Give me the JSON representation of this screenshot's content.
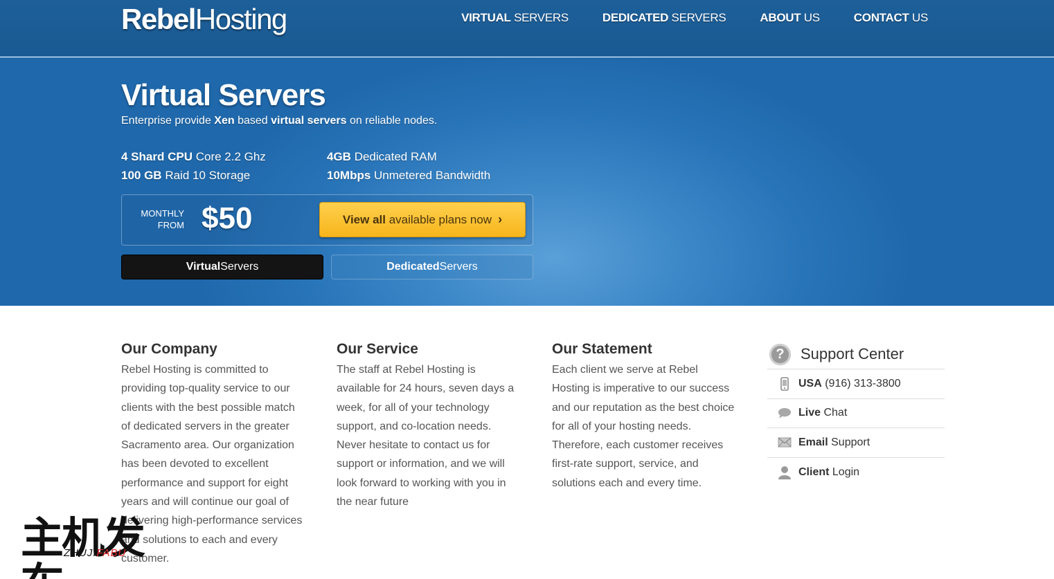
{
  "header": {
    "logo_bold": "Rebel",
    "logo_light": "Hosting",
    "nav": [
      {
        "bold": "VIRTUAL",
        "rest": " SERVERS"
      },
      {
        "bold": "DEDICATED",
        "rest": " SERVERS"
      },
      {
        "bold": "ABOUT",
        "rest": " US"
      },
      {
        "bold": "CONTACT",
        "rest": " US"
      }
    ]
  },
  "hero": {
    "title_bold": "Virtual",
    "title_light": " Servers",
    "subtitle": {
      "p1": "Enterprise provide ",
      "b1": "Xen",
      "p2": " based ",
      "b2": "virtual servers",
      "p3": " on reliable nodes."
    },
    "specs": [
      {
        "bold": "4 Shard CPU",
        "rest": " Core 2.2 Ghz"
      },
      {
        "bold": "100 GB",
        "rest": " Raid 10 Storage"
      },
      {
        "bold": "4GB",
        "rest": " Dedicated RAM"
      },
      {
        "bold": "10Mbps",
        "rest": " Unmetered Bandwidth"
      }
    ],
    "price": {
      "label_line1": "MONTHLY",
      "label_line2": "FROM",
      "amount": "$50"
    },
    "cta": {
      "w1": "View",
      "w2": "all",
      "rest": " available plans now"
    },
    "tabs": [
      {
        "bold": "Virtual",
        "rest": " Servers"
      },
      {
        "bold": "Dedicated",
        "rest": " Servers"
      }
    ]
  },
  "content": {
    "company": {
      "title": "Our Company",
      "text": "Rebel Hosting is committed to providing top-quality service to our clients with the best possible match of dedicated servers in the greater Sacramento area. Our organization has been devoted to excellent performance and support for eight years and will continue our goal of delivering high-performance services and solutions to each and every customer."
    },
    "service": {
      "title": "Our Service",
      "text": "The staff at Rebel Hosting is available for 24 hours, seven days a week, for all of your technology support, and co-location needs. Never hesitate to contact us for support or information, and we will look forward to working with you in the near future"
    },
    "statement": {
      "title": "Our Statement",
      "text": "Each client we serve at Rebel Hosting is imperative to our success and our reputation as the best  choice for all of your hosting needs. Therefore, each customer receives first-rate support, service, and solutions each and every time."
    }
  },
  "support": {
    "title": "Support Center",
    "items": [
      {
        "icon": "phone-icon",
        "bold": "USA",
        "rest": " (916) 313-3800"
      },
      {
        "icon": "chat-icon",
        "bold": "Live",
        "rest": " Chat"
      },
      {
        "icon": "email-icon",
        "bold": "Email",
        "rest": " Support"
      },
      {
        "icon": "user-icon",
        "bold": "Client",
        "rest": " Login"
      }
    ]
  },
  "watermark": {
    "chars": "主机发布",
    "latin_a": "ZHUJI",
    "latin_b": "FABU"
  }
}
